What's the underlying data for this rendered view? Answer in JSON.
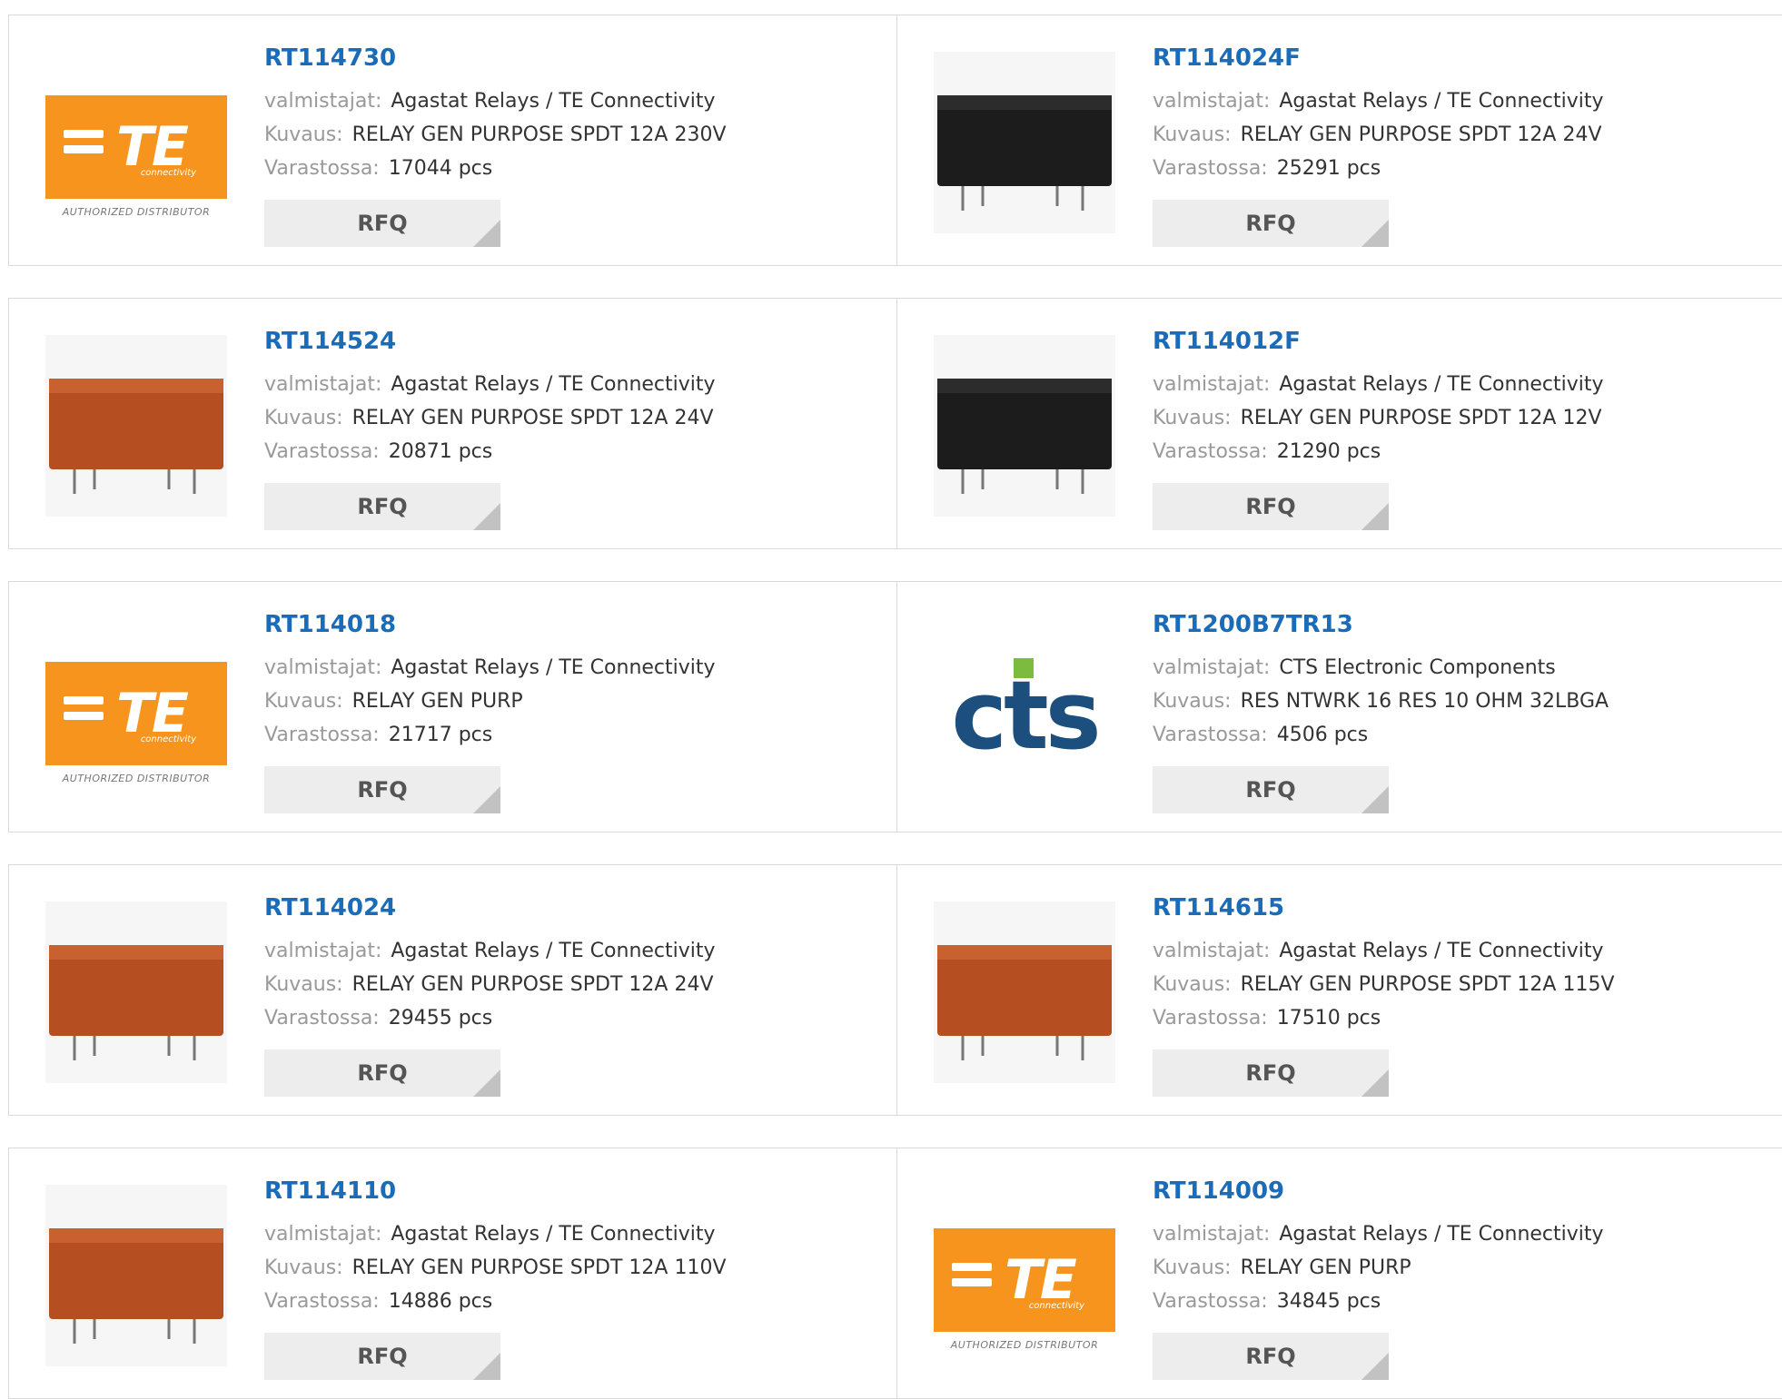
{
  "labels": {
    "manufacturer": "valmistajat:",
    "description": "Kuvaus:",
    "stock": "Varastossa:",
    "rfq": "RFQ"
  },
  "logos": {
    "te_text": "TE",
    "te_sub": "connectivity",
    "te_authorized": "AUTHORIZED DISTRIBUTOR",
    "cts_text": "cts"
  },
  "colors": {
    "link": "#1a6bb8",
    "te_orange": "#f7941e",
    "cts_blue": "#1c4f7d",
    "cts_green": "#7dbb3f",
    "relay_black": "#1c1c1c",
    "relay_orange": "#b54f22"
  },
  "products": [
    {
      "part": "RT114730",
      "manufacturer": "Agastat Relays / TE Connectivity",
      "description": "RELAY GEN PURPOSE SPDT 12A 230V",
      "stock": "17044 pcs",
      "image": "te-logo"
    },
    {
      "part": "RT114024F",
      "manufacturer": "Agastat Relays / TE Connectivity",
      "description": "RELAY GEN PURPOSE SPDT 12A 24V",
      "stock": "25291 pcs",
      "image": "black-relay"
    },
    {
      "part": "RT114524",
      "manufacturer": "Agastat Relays / TE Connectivity",
      "description": "RELAY GEN PURPOSE SPDT 12A 24V",
      "stock": "20871 pcs",
      "image": "orange-relay"
    },
    {
      "part": "RT114012F",
      "manufacturer": "Agastat Relays / TE Connectivity",
      "description": "RELAY GEN PURPOSE SPDT 12A 12V",
      "stock": "21290 pcs",
      "image": "black-relay"
    },
    {
      "part": "RT114018",
      "manufacturer": "Agastat Relays / TE Connectivity",
      "description": "RELAY GEN PURP",
      "stock": "21717 pcs",
      "image": "te-logo"
    },
    {
      "part": "RT1200B7TR13",
      "manufacturer": "CTS Electronic Components",
      "description": "RES NTWRK 16 RES 10 OHM 32LBGA",
      "stock": "4506 pcs",
      "image": "cts-logo"
    },
    {
      "part": "RT114024",
      "manufacturer": "Agastat Relays / TE Connectivity",
      "description": "RELAY GEN PURPOSE SPDT 12A 24V",
      "stock": "29455 pcs",
      "image": "orange-relay"
    },
    {
      "part": "RT114615",
      "manufacturer": "Agastat Relays / TE Connectivity",
      "description": "RELAY GEN PURPOSE SPDT 12A 115V",
      "stock": "17510 pcs",
      "image": "orange-relay"
    },
    {
      "part": "RT114110",
      "manufacturer": "Agastat Relays / TE Connectivity",
      "description": "RELAY GEN PURPOSE SPDT 12A 110V",
      "stock": "14886 pcs",
      "image": "orange-relay"
    },
    {
      "part": "RT114009",
      "manufacturer": "Agastat Relays / TE Connectivity",
      "description": "RELAY GEN PURP",
      "stock": "34845 pcs",
      "image": "te-logo"
    }
  ]
}
